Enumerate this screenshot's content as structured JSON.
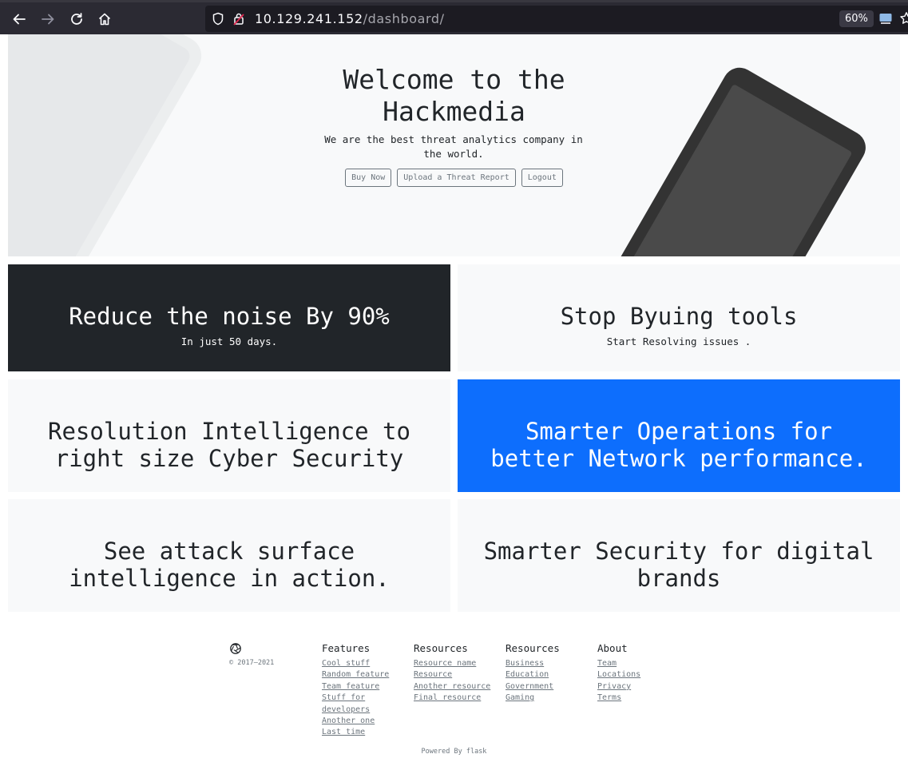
{
  "browser": {
    "url_host": "10.129.241.152",
    "url_path": "/dashboard/",
    "zoom": "60%"
  },
  "hero": {
    "title": "Welcome to the Hackmedia",
    "subtitle": "We are the best threat analytics company in the world.",
    "buttons": [
      "Buy Now",
      "Upload a Threat Report",
      "Logout"
    ]
  },
  "panels": [
    {
      "title": "Reduce the noise By 90%",
      "text": "In just 50 days.",
      "bg": "#212529"
    },
    {
      "title": "Stop Byuing tools",
      "text": "Start Resolving issues .",
      "bg": "#f8f9fa"
    },
    {
      "title": "Resolution Intelligence to right size Cyber Security",
      "text": "",
      "bg": "#f8f9fa"
    },
    {
      "title": "Smarter Operations for better Network performance.",
      "text": "",
      "bg": "#0d6efd"
    },
    {
      "title": "See attack surface intelligence in action.",
      "text": "",
      "bg": "#f8f9fa"
    },
    {
      "title": "Smarter Security for digital brands",
      "text": "",
      "bg": "#f8f9fa"
    }
  ],
  "footer": {
    "brand_icon": "aperture-icon",
    "copyright": "© 2017–2021",
    "columns": [
      {
        "heading": "Features",
        "links": [
          "Cool stuff",
          "Random feature",
          "Team feature",
          "Stuff for developers",
          "Another one",
          "Last time"
        ]
      },
      {
        "heading": "Resources",
        "links": [
          "Resource name",
          "Resource",
          "Another resource",
          "Final resource"
        ]
      },
      {
        "heading": "Resources",
        "links": [
          "Business",
          "Education",
          "Government",
          "Gaming"
        ]
      },
      {
        "heading": "About",
        "links": [
          "Team",
          "Locations",
          "Privacy",
          "Terms"
        ]
      }
    ],
    "powered_by": "Powered By flask"
  }
}
